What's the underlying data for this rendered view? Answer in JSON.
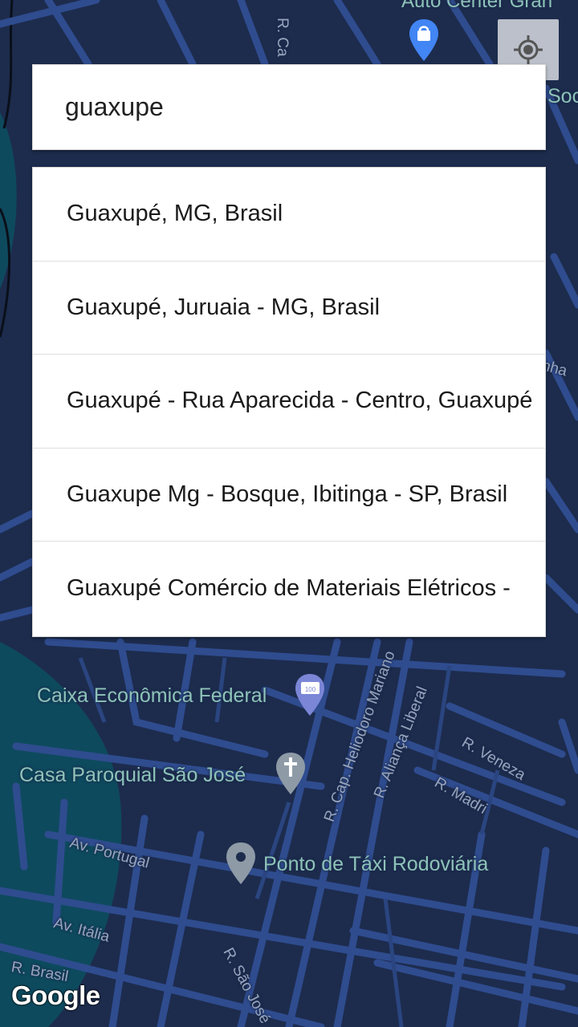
{
  "map": {
    "top_label": "Auto Center Gran",
    "right_label_top": "Soc",
    "right_label_mid": "nha",
    "places": [
      {
        "name": "Caixa Econômica Federal",
        "icon": "bank-pin-icon"
      },
      {
        "name": "Casa Paroquial São José",
        "icon": "church-pin-icon"
      },
      {
        "name": "Ponto de Táxi Rodoviária",
        "icon": "taxi-pin-icon"
      }
    ],
    "streets": [
      "R. Ca",
      "R. Cap. Heliodoro Mariano",
      "R. Aliança Liberal",
      "R. Veneza",
      "R. Madri",
      "Av. Portugal",
      "Av. Itália",
      "R. Brasil",
      "R. São José"
    ],
    "attribution": "Google"
  },
  "search": {
    "value": "guaxupe"
  },
  "suggestions": [
    "Guaxupé, MG, Brasil",
    "Guaxupé, Juruaia - MG, Brasil",
    "Guaxupé - Rua Aparecida - Centro, Guaxupé",
    "Guaxupe Mg - Bosque, Ibitinga - SP, Brasil",
    "Guaxupé Comércio de Materiais Elétricos - "
  ],
  "colors": {
    "map_background": "#1d2c4d",
    "road": "#2f4c8f",
    "water": "#0e4a5e",
    "label": "#8ec3b9"
  }
}
